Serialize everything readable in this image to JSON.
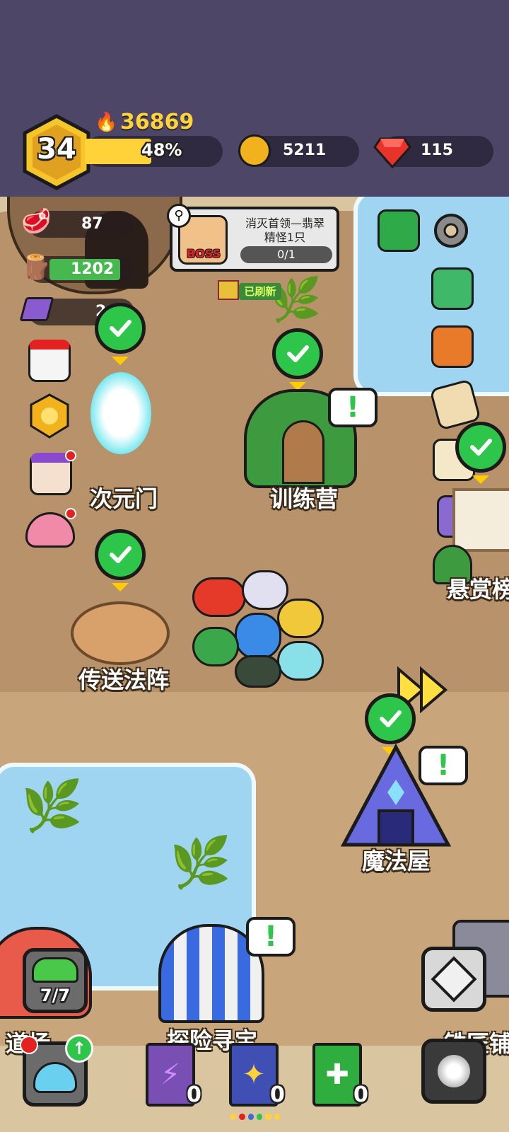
{
  "player": {
    "level": "34",
    "power": "36869",
    "exp_percent_label": "48%",
    "exp_fraction": 0.48
  },
  "currency": {
    "gold": "5211",
    "gems": "115"
  },
  "resources": {
    "meat": "87",
    "wood": "1202",
    "ore": "249"
  },
  "quest": {
    "line1": "消灭首领—翡翠",
    "line2": "精怪1只",
    "progress": "0/1",
    "boss_badge": "BOSS"
  },
  "refresh_text": "已刷新",
  "buildings": {
    "portal": "次元门",
    "training": "训练营",
    "teleport": "传送法阵",
    "magic": "魔法屋",
    "bounty": "悬赏榜",
    "prop_shop": "道场",
    "treasure": "探险寻宝",
    "smith": "铁匠铺"
  },
  "hero_slots": "7/7",
  "books": [
    {
      "count": "0",
      "color": "#7a4fb3",
      "icon": "lightning-icon"
    },
    {
      "count": "0",
      "color": "#3f4fb3",
      "icon": "wing-icon"
    },
    {
      "count": "0",
      "color": "#2fae3f",
      "icon": "plus-icon"
    }
  ],
  "colors": {
    "accent_gold": "#ffd23a",
    "check_green": "#2ec64a",
    "topbar": "#4d4667"
  }
}
